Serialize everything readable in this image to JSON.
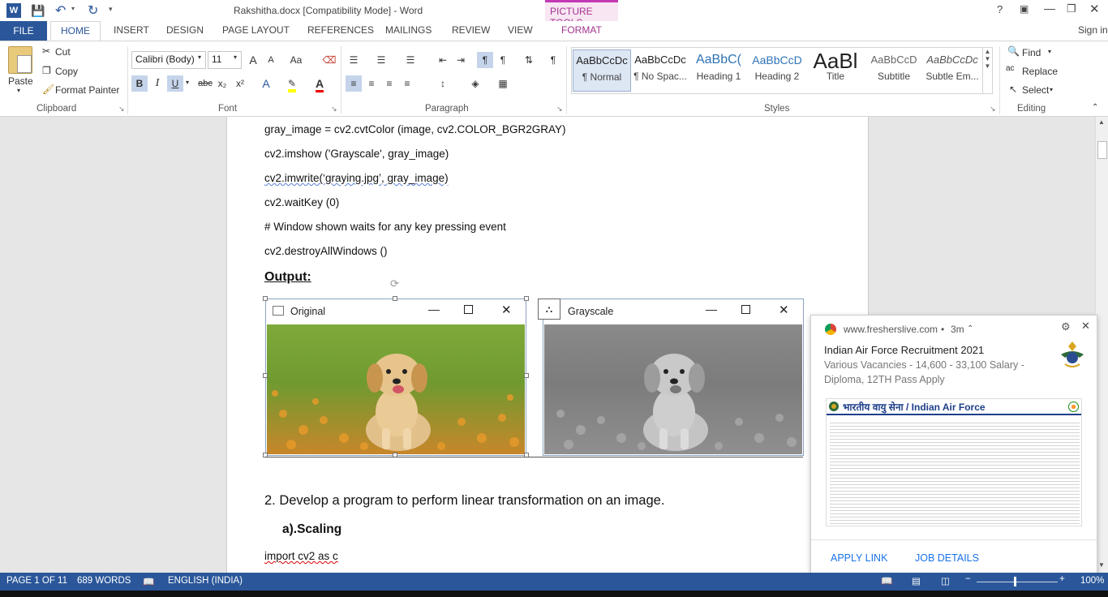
{
  "titlebar": {
    "title": "Rakshitha.docx [Compatibility Mode] - Word",
    "picture_tools": "PICTURE TOOLS",
    "help": "?",
    "sign_in": "Sign in"
  },
  "tabs": [
    "FILE",
    "HOME",
    "INSERT",
    "DESIGN",
    "PAGE LAYOUT",
    "REFERENCES",
    "MAILINGS",
    "REVIEW",
    "VIEW",
    "FORMAT"
  ],
  "clipboard": {
    "paste": "Paste",
    "cut": "Cut",
    "copy": "Copy",
    "format_painter": "Format Painter",
    "label": "Clipboard"
  },
  "font": {
    "family": "Calibri (Body)",
    "size": "11",
    "label": "Font",
    "bold": "B",
    "italic": "I",
    "underline": "U",
    "strike": "abc",
    "sub": "x₂",
    "sup": "x²",
    "grow": "A",
    "shrink": "A",
    "case": "Aa"
  },
  "paragraph": {
    "label": "Paragraph"
  },
  "styles": {
    "label": "Styles",
    "items": [
      {
        "preview": "AaBbCcDc",
        "name": "¶ Normal"
      },
      {
        "preview": "AaBbCcDc",
        "name": "¶ No Spac..."
      },
      {
        "preview": "AaBbC(",
        "name": "Heading 1"
      },
      {
        "preview": "AaBbCcD",
        "name": "Heading 2"
      },
      {
        "preview": "AaBl",
        "name": "Title"
      },
      {
        "preview": "AaBbCcD",
        "name": "Subtitle"
      },
      {
        "preview": "AaBbCcDc",
        "name": "Subtle Em..."
      }
    ]
  },
  "editing": {
    "find": "Find",
    "replace": "Replace",
    "select": "Select",
    "label": "Editing"
  },
  "document": {
    "lines": [
      "gray_image = cv2.cvtColor (image, cv2.COLOR_BGR2GRAY)",
      "cv2.imshow ('Grayscale', gray_image)",
      "cv2.imwrite(‘graying.jpg’, gray_image)",
      "cv2.waitKey (0)",
      "# Window shown waits for any key pressing event",
      "cv2.destroyAllWindows ()"
    ],
    "output_heading": "Output:",
    "window_original": "Original",
    "window_grayscale": "Grayscale",
    "item2": "2. Develop a program to perform linear transformation on an image.",
    "scaling": "a).Scaling",
    "import_line": "import cv2 as c"
  },
  "notification": {
    "source": "www.fresherslive.com",
    "time": "3m",
    "title": "Indian Air Force Recruitment 2021",
    "body": "Various Vacancies - 14,600 - 33,100 Salary - Diploma, 12TH Pass Apply",
    "banner_title": "भारतीय वायु सेना / Indian Air Force",
    "apply": "APPLY LINK",
    "details": "JOB DETAILS"
  },
  "status": {
    "page": "PAGE 1 OF 11",
    "words": "689 WORDS",
    "language": "ENGLISH (INDIA)",
    "zoom": "100%"
  },
  "colors": {
    "word_blue": "#2b579a",
    "picture_tools": "#c239b3"
  }
}
